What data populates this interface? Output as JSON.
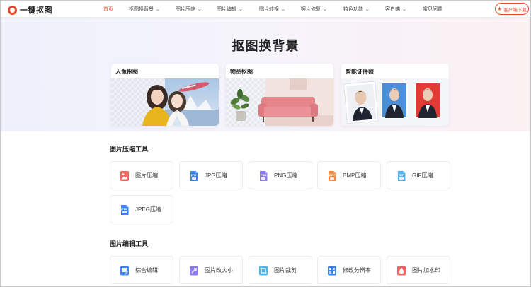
{
  "header": {
    "logo_text": "一键抠图",
    "nav": [
      {
        "label": "首页",
        "active": true,
        "dropdown": false
      },
      {
        "label": "抠图换背景",
        "active": false,
        "dropdown": true
      },
      {
        "label": "图片压缩",
        "active": false,
        "dropdown": true
      },
      {
        "label": "图片编辑",
        "active": false,
        "dropdown": true
      },
      {
        "label": "图片转换",
        "active": false,
        "dropdown": true
      },
      {
        "label": "照片修复",
        "active": false,
        "dropdown": true
      },
      {
        "label": "特色功能",
        "active": false,
        "dropdown": true
      },
      {
        "label": "客户端",
        "active": false,
        "dropdown": true
      },
      {
        "label": "常见问题",
        "active": false,
        "dropdown": false
      }
    ],
    "download_label": "客户端下载",
    "accent": "#e8472f"
  },
  "hero": {
    "title": "抠图换背景",
    "cards": [
      {
        "title": "人像抠图"
      },
      {
        "title": "物品抠图"
      },
      {
        "title": "智能证件照"
      }
    ]
  },
  "compress": {
    "title": "图片压缩工具",
    "tools": [
      {
        "label": "图片压缩",
        "icon": "image-compress-icon",
        "color": "#f0655f",
        "tag": ""
      },
      {
        "label": "JPG压缩",
        "icon": "jpg-file-icon",
        "color": "#3b82f6",
        "tag": "JPG"
      },
      {
        "label": "PNG压缩",
        "icon": "png-file-icon",
        "color": "#8b7cf0",
        "tag": "PNG"
      },
      {
        "label": "BMP压缩",
        "icon": "bmp-file-icon",
        "color": "#f08a3c",
        "tag": "BMP"
      },
      {
        "label": "GIF压缩",
        "icon": "gif-file-icon",
        "color": "#4fb3e8",
        "tag": "GIF"
      },
      {
        "label": "JPEG压缩",
        "icon": "jpeg-file-icon",
        "color": "#3b82f6",
        "tag": "JPEG"
      }
    ]
  },
  "edit": {
    "title": "图片编辑工具",
    "tools": [
      {
        "label": "综合编辑",
        "icon": "edit-icon",
        "color": "#3b82f6"
      },
      {
        "label": "图片改大小",
        "icon": "resize-icon",
        "color": "#8b7cf0"
      },
      {
        "label": "图片裁剪",
        "icon": "crop-icon",
        "color": "#4fb3e8"
      },
      {
        "label": "修改分辨率",
        "icon": "resolution-icon",
        "color": "#3b82f6"
      },
      {
        "label": "图片加水印",
        "icon": "watermark-icon",
        "color": "#f0655f"
      }
    ]
  }
}
